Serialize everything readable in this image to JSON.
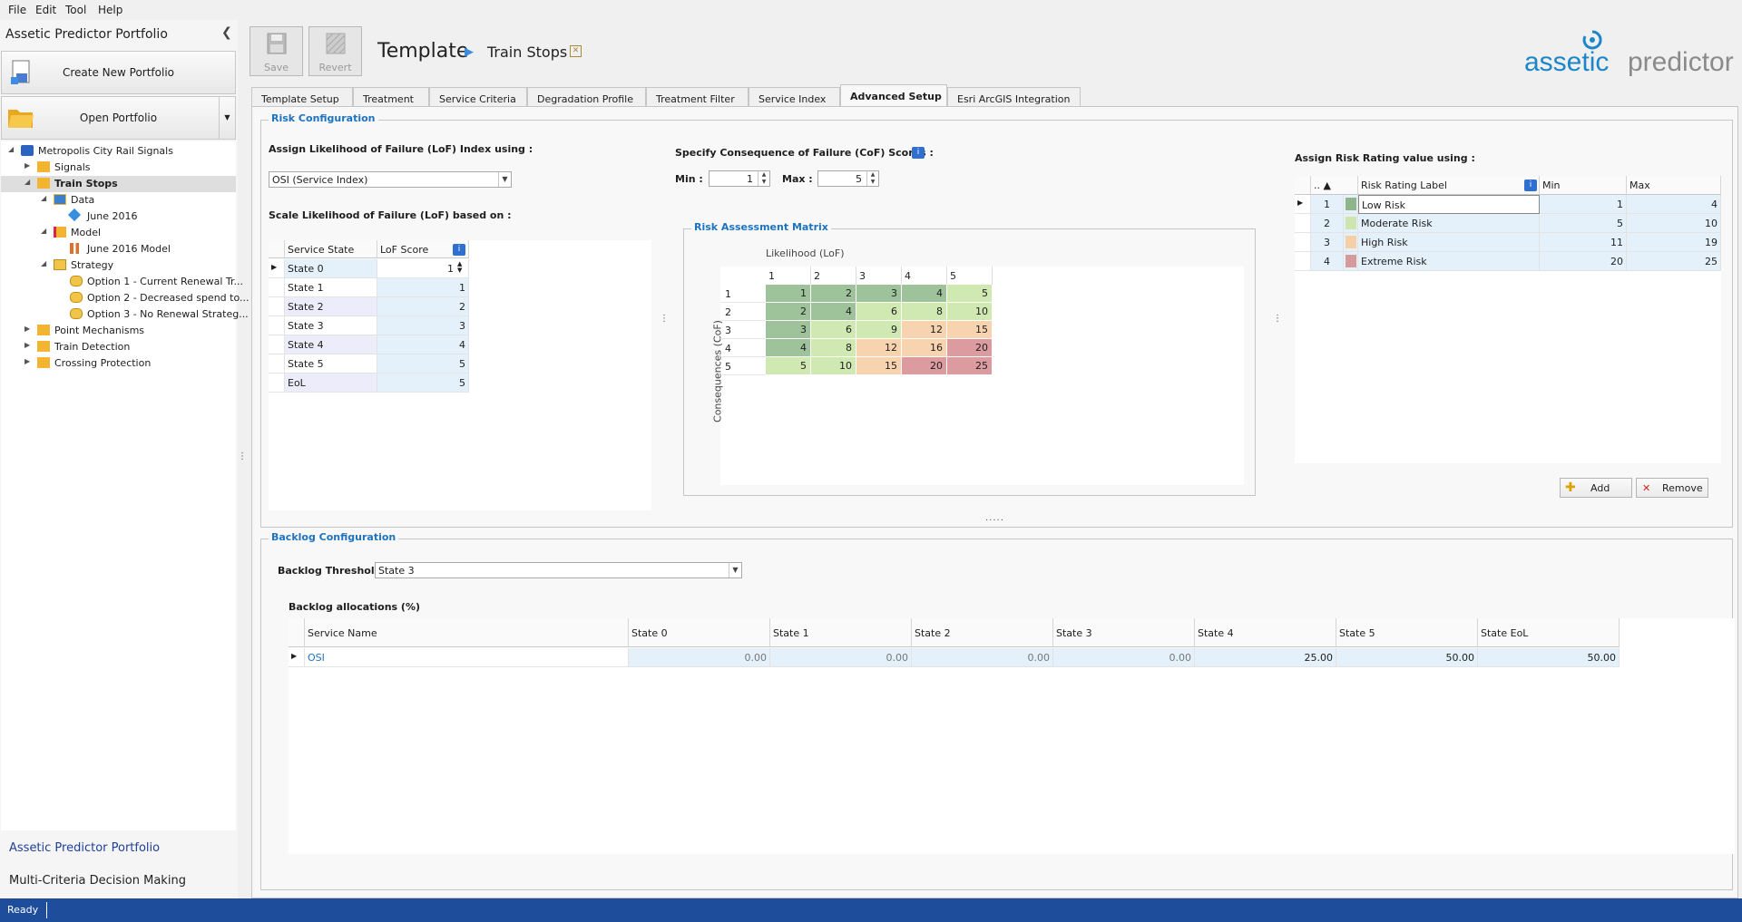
{
  "menu": [
    "File",
    "Edit",
    "Tool",
    "Help"
  ],
  "left_panel": {
    "title": "Assetic Predictor Portfolio",
    "create_label": "Create New Portfolio",
    "open_label": "Open Portfolio",
    "tree": [
      {
        "label": "Metropolis City Rail Signals",
        "level": 0,
        "expanded": true,
        "icon": "portfolio-icon"
      },
      {
        "label": "Signals",
        "level": 1,
        "expanded": false,
        "icon": "folder-icon"
      },
      {
        "label": "Train Stops",
        "level": 1,
        "expanded": true,
        "icon": "folder-icon",
        "selected": true
      },
      {
        "label": "Data",
        "level": 2,
        "expanded": true,
        "icon": "data-icon"
      },
      {
        "label": "June 2016",
        "level": 3,
        "icon": "dataset-icon"
      },
      {
        "label": "Model",
        "level": 2,
        "expanded": true,
        "icon": "model-icon"
      },
      {
        "label": "June 2016 Model",
        "level": 3,
        "icon": "chart-icon"
      },
      {
        "label": "Strategy",
        "level": 2,
        "expanded": true,
        "icon": "strategy-folder-icon"
      },
      {
        "label": "Option 1 - Current Renewal Tr...",
        "level": 3,
        "icon": "strategy-icon"
      },
      {
        "label": "Option 2 - Decreased spend to...",
        "level": 3,
        "icon": "strategy-icon"
      },
      {
        "label": "Option 3 - No Renewal Strateg...",
        "level": 3,
        "icon": "strategy-icon"
      },
      {
        "label": "Point Mechanisms",
        "level": 1,
        "expanded": false,
        "icon": "folder-icon"
      },
      {
        "label": "Train Detection",
        "level": 1,
        "expanded": false,
        "icon": "folder-icon"
      },
      {
        "label": "Crossing Protection",
        "level": 1,
        "expanded": false,
        "icon": "folder-icon"
      }
    ],
    "nav": [
      "Assetic Predictor Portfolio",
      "Multi-Criteria Decision Making"
    ]
  },
  "toolbar": {
    "save": "Save",
    "revert": "Revert"
  },
  "breadcrumb": {
    "root": "Template",
    "current": "Train Stops"
  },
  "logo": {
    "part1": "assetic",
    "part2": "predictor"
  },
  "tabs": [
    "Template Setup",
    "Treatment",
    "Service Criteria",
    "Degradation Profile",
    "Treatment Filter",
    "Service Index",
    "Advanced Setup",
    "Esri ArcGIS Integration"
  ],
  "active_tab": "Advanced Setup",
  "risk": {
    "title": "Risk Configuration",
    "lof_label": "Assign Likelihood of Failure (LoF) Index using :",
    "lof_value": "OSI (Service Index)",
    "scale_label": "Scale Likelihood of Failure (LoF) based on :",
    "scale_headers": [
      "Service State",
      "LoF Score"
    ],
    "scale_rows": [
      [
        "State 0",
        "1"
      ],
      [
        "State 1",
        "1"
      ],
      [
        "State 2",
        "2"
      ],
      [
        "State 3",
        "3"
      ],
      [
        "State 4",
        "4"
      ],
      [
        "State 5",
        "5"
      ],
      [
        "EoL",
        "5"
      ]
    ],
    "cof_label": "Specify Consequence of Failure (CoF) Scores :",
    "min_label": "Min :",
    "min_value": "1",
    "max_label": "Max :",
    "max_value": "5",
    "matrix_title": "Risk Assessment Matrix",
    "matrix_xlabel": "Likelihood (LoF)",
    "matrix_ylabel": "Consequences (CoF)",
    "matrix_cols": [
      "1",
      "2",
      "3",
      "4",
      "5"
    ],
    "matrix_rows": [
      "1",
      "2",
      "3",
      "4",
      "5"
    ],
    "matrix_values": [
      [
        1,
        2,
        3,
        4,
        5
      ],
      [
        2,
        4,
        6,
        8,
        10
      ],
      [
        3,
        6,
        9,
        12,
        15
      ],
      [
        4,
        8,
        12,
        16,
        20
      ],
      [
        5,
        10,
        15,
        20,
        25
      ]
    ],
    "rating_label": "Assign Risk Rating value using :",
    "rating_headers": [
      "..",
      "Risk Rating Label",
      "Min",
      "Max"
    ],
    "ratings": [
      {
        "id": "1",
        "label": "Low Risk",
        "min": "1",
        "max": "4",
        "color": "#8fb58c"
      },
      {
        "id": "2",
        "label": "Moderate Risk",
        "min": "5",
        "max": "10",
        "color": "#cfe5b0"
      },
      {
        "id": "3",
        "label": "High Risk",
        "min": "11",
        "max": "19",
        "color": "#f6cfa8"
      },
      {
        "id": "4",
        "label": "Extreme Risk",
        "min": "20",
        "max": "25",
        "color": "#d69a9c"
      }
    ],
    "add_label": "Add",
    "remove_label": "Remove"
  },
  "backlog": {
    "title": "Backlog Configuration",
    "threshold_label": "Backlog Threshold",
    "threshold_value": "State 3",
    "alloc_label": "Backlog allocations (%)",
    "headers": [
      "Service Name",
      "State 0",
      "State 1",
      "State 2",
      "State 3",
      "State 4",
      "State 5",
      "State EoL"
    ],
    "row": [
      "OSI",
      "0.00",
      "0.00",
      "0.00",
      "0.00",
      "25.00",
      "50.00",
      "50.00"
    ]
  },
  "status": "Ready"
}
